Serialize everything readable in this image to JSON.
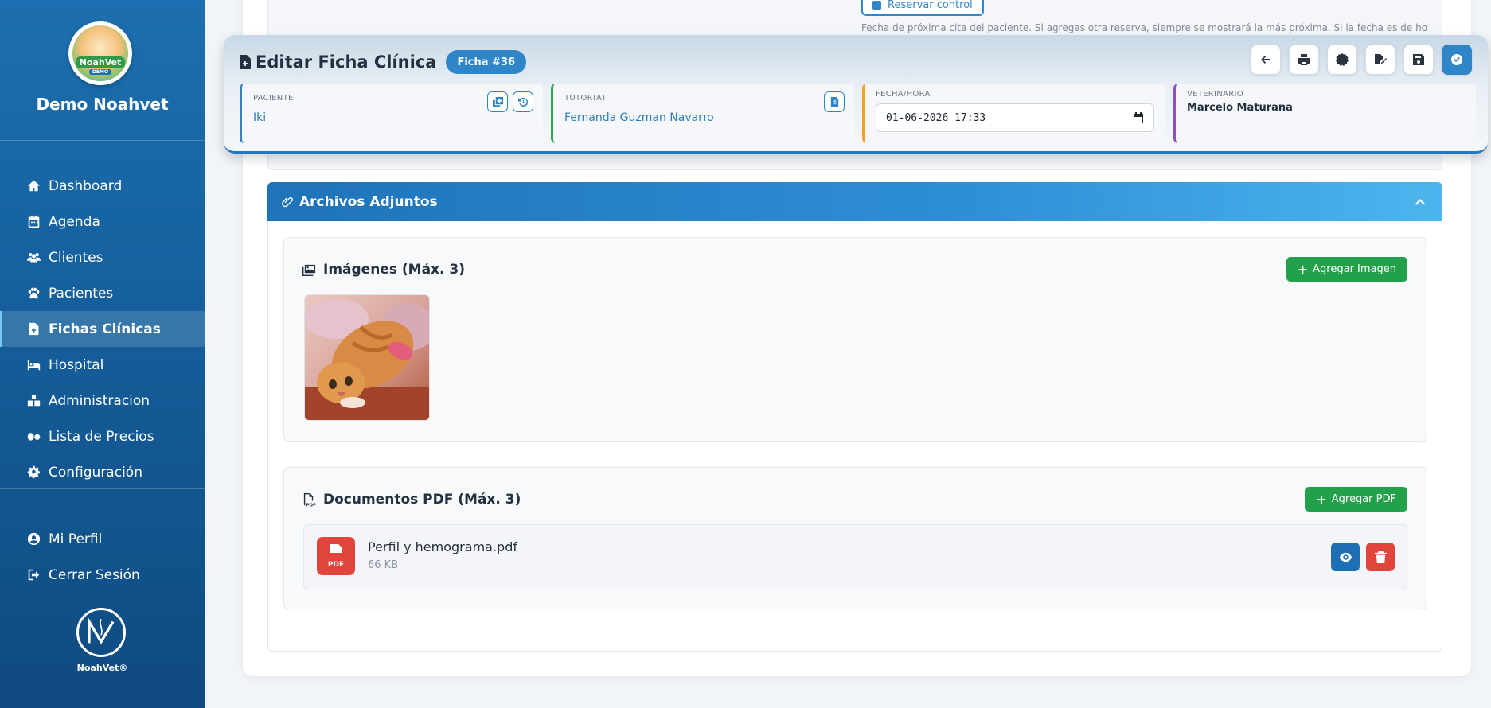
{
  "sidebar": {
    "logo_text": "NoahVet",
    "logo_sub": "DEMO",
    "brand": "Demo Noahvet",
    "items": [
      {
        "label": "Dashboard",
        "icon": "home-icon"
      },
      {
        "label": "Agenda",
        "icon": "calendar-icon"
      },
      {
        "label": "Clientes",
        "icon": "users-icon"
      },
      {
        "label": "Pacientes",
        "icon": "paw-icon"
      },
      {
        "label": "Fichas Clínicas",
        "icon": "file-medical-icon",
        "active": true
      },
      {
        "label": "Hospital",
        "icon": "hospital-bed-icon"
      },
      {
        "label": "Administracion",
        "icon": "boxes-icon"
      },
      {
        "label": "Lista de Precios",
        "icon": "pills-icon"
      },
      {
        "label": "Configuración",
        "icon": "gear-icon"
      }
    ],
    "bottom_items": [
      {
        "label": "Mi Perfil",
        "icon": "user-circle-icon"
      },
      {
        "label": "Cerrar Sesión",
        "icon": "sign-out-icon"
      }
    ],
    "footer_brand": "NoahVet®"
  },
  "top_strip": {
    "reserve_label": "Reservar control",
    "note": "Fecha de próxima cita del paciente. Si agregas otra reserva, siempre se mostrará la más próxima. Si la fecha es de hoy o"
  },
  "header": {
    "title": "Editar Ficha Clínica",
    "badge": "Ficha #36",
    "actions": [
      "arrow-left-icon",
      "print-icon",
      "certificate-icon",
      "file-signature-icon",
      "save-icon",
      "check-circle-icon"
    ],
    "paciente": {
      "label": "PACIENTE",
      "value": "Iki"
    },
    "tutor": {
      "label": "TUTOR(A)",
      "value": "Fernanda Guzman Navarro"
    },
    "fecha": {
      "label": "FECHA/HORA",
      "value": "01-06-2026 17:33"
    },
    "veterinario": {
      "label": "VETERINARIO",
      "value": "Marcelo Maturana"
    }
  },
  "attachments": {
    "title": "Archivos Adjuntos",
    "images": {
      "title": "Imágenes (Máx. 3)",
      "add_label": "Agregar Imagen"
    },
    "pdfs": {
      "title": "Documentos PDF (Máx. 3)",
      "add_label": "Agregar PDF",
      "files": [
        {
          "name": "Perfil y hemograma.pdf",
          "size": "66 KB",
          "icon_label": "PDF"
        }
      ]
    }
  },
  "colors": {
    "primary": "#2e86c9",
    "success": "#22a04a",
    "danger": "#e0443b",
    "sidebar": "#1c6fb0"
  }
}
